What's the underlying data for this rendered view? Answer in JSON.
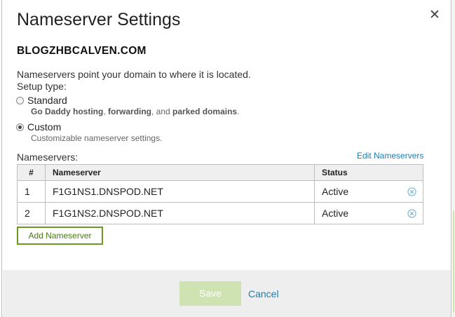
{
  "dialog": {
    "title": "Nameserver Settings",
    "close_glyph": "✕",
    "domain": "BLOGZHBCALVEN.COM",
    "description": "Nameservers point your domain to where it is located.",
    "setup_label": "Setup type:",
    "options": [
      {
        "label": "Standard",
        "checked": false,
        "sub_parts": [
          "Go Daddy hosting",
          ", ",
          "forwarding",
          ", and ",
          "parked domains",
          "."
        ]
      },
      {
        "label": "Custom",
        "checked": true,
        "sub": "Customizable nameserver settings."
      }
    ],
    "nameservers_label": "Nameservers:",
    "edit_link": "Edit Nameservers",
    "table": {
      "headers": [
        "#",
        "Nameserver",
        "Status"
      ],
      "rows": [
        {
          "num": "1",
          "nameserver": "F1G1NS1.DNSPOD.NET",
          "status": "Active"
        },
        {
          "num": "2",
          "nameserver": "F1G1NS2.DNSPOD.NET",
          "status": "Active"
        }
      ]
    },
    "add_button": "Add Nameserver",
    "footer": {
      "save": "Save",
      "cancel": "Cancel"
    }
  },
  "icons": {
    "remove": "remove-circle-icon",
    "close": "close-icon"
  },
  "colors": {
    "link": "#1a7fb0",
    "add_button_border": "#6a9a22",
    "save_disabled": "#cfe3b2",
    "footer_bg": "#eeeeee"
  }
}
